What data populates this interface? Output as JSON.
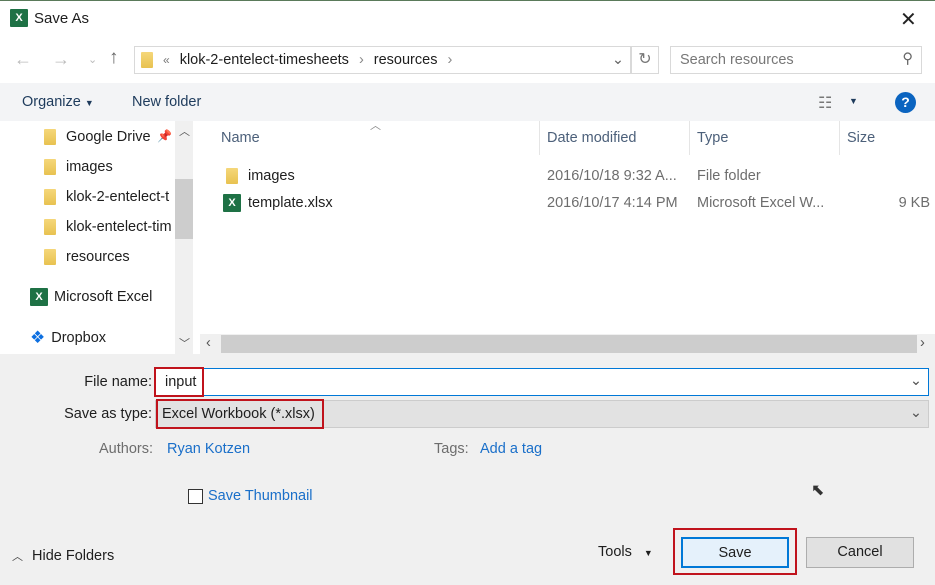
{
  "window": {
    "title": "Save As"
  },
  "address": {
    "overflow": "«",
    "segments": [
      "klok-2-entelect-timesheets",
      "resources"
    ]
  },
  "search": {
    "placeholder": "Search resources"
  },
  "toolbar": {
    "organize": "Organize",
    "new_folder": "New folder"
  },
  "nav": {
    "items": [
      "Google Drive",
      "images",
      "klok-2-entelect-t",
      "klok-entelect-tim",
      "resources",
      "Microsoft Excel",
      "Dropbox"
    ]
  },
  "columns": [
    "Name",
    "Date modified",
    "Type",
    "Size"
  ],
  "files": [
    {
      "name": "images",
      "date": "2016/10/18 9:32 A...",
      "type": "File folder",
      "size": "",
      "icon": "folder-icon"
    },
    {
      "name": "template.xlsx",
      "date": "2016/10/17 4:14 PM",
      "type": "Microsoft Excel W...",
      "size": "9 KB",
      "icon": "excel-file-icon"
    }
  ],
  "form": {
    "file_name_label": "File name:",
    "file_name_value": "input",
    "type_label": "Save as type:",
    "type_value": "Excel Workbook (*.xlsx)",
    "authors_label": "Authors:",
    "authors_value": "Ryan Kotzen",
    "tags_label": "Tags:",
    "tags_value": "Add a tag",
    "thumbnail_label": "Save Thumbnail",
    "thumbnail_checked": false
  },
  "footer": {
    "hide_folders": "Hide Folders",
    "tools": "Tools",
    "save": "Save",
    "cancel": "Cancel"
  },
  "colors": {
    "highlight": "#c0131c",
    "link": "#1a6fc9",
    "accent": "#0078d7"
  }
}
